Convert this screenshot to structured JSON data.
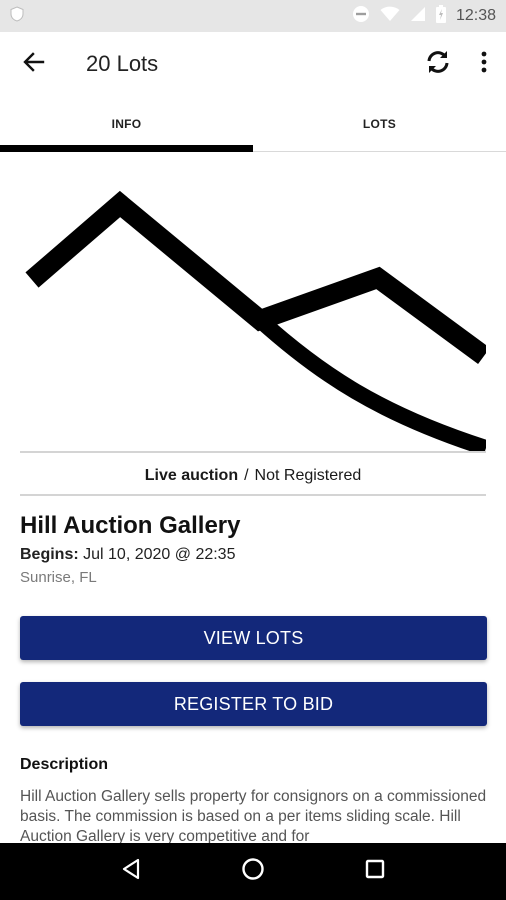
{
  "status_bar": {
    "time": "12:38",
    "icons": [
      "shield-icon",
      "do-not-disturb-icon",
      "wifi-icon",
      "signal-icon",
      "battery-icon"
    ]
  },
  "app_bar": {
    "title": "20 Lots",
    "icons": [
      "back-arrow-icon",
      "refresh-icon",
      "overflow-menu-icon"
    ]
  },
  "tabs": [
    {
      "label": "INFO",
      "active": true
    },
    {
      "label": "LOTS",
      "active": false
    }
  ],
  "auction": {
    "type_label": "Live auction",
    "separator": "/",
    "registration_status": "Not Registered",
    "gallery_name": "Hill Auction Gallery",
    "begins_label": "Begins:",
    "begins_value": "Jul 10, 2020 @ 22:35",
    "location": "Sunrise, FL"
  },
  "buttons": {
    "view_lots": "VIEW LOTS",
    "register": "REGISTER TO BID"
  },
  "description": {
    "heading": "Description",
    "body": "Hill Auction Gallery sells property for consignors on a commissioned basis. The commission is based on a per items sliding scale. Hill Auction Gallery is very competitive and for"
  },
  "colors": {
    "primary_button": "#13287a",
    "status_bar": "#e6e6e6",
    "nav_bar": "#000000",
    "tab_indicator": "#000000"
  },
  "nav_bar": {
    "icons": [
      "back-triangle-icon",
      "home-circle-icon",
      "recents-square-icon"
    ]
  }
}
